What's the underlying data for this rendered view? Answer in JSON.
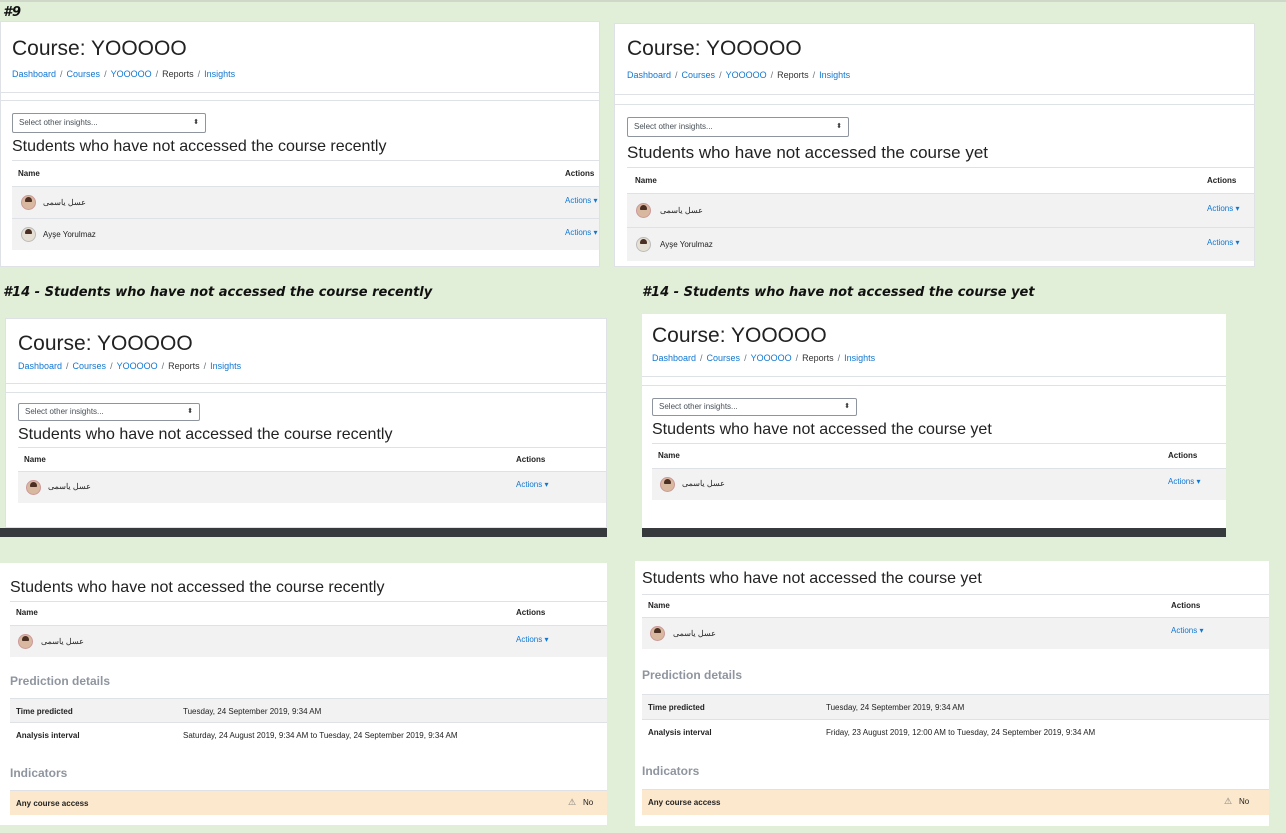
{
  "labels": {
    "p9": "#9",
    "p14_recent": "#14 - Students who have not accessed the course recently",
    "p14_yet": "#14 - Students who have not accessed the course yet"
  },
  "course": {
    "title": "Course: YOOOOO",
    "breadcrumb": [
      "Dashboard",
      "Courses",
      "YOOOOO",
      "Reports",
      "Insights"
    ],
    "breadcrumb_sep": "/"
  },
  "select": {
    "label": "Select other insights...",
    "caret": "⬍"
  },
  "insights": {
    "recent": "Students who have not accessed the course recently",
    "yet": "Students who have not accessed the course yet"
  },
  "table": {
    "col_name": "Name",
    "col_actions": "Actions",
    "action_label": "Actions ▾"
  },
  "users": [
    "عسل یاسمی",
    "Ayşe Yorulmaz"
  ],
  "prediction": {
    "title": "Prediction details",
    "time_label": "Time predicted",
    "interval_label": "Analysis interval",
    "recent": {
      "time": "Tuesday, 24 September 2019, 9:34 AM",
      "interval": "Saturday, 24 August 2019, 9:34 AM to Tuesday, 24 September 2019, 9:34 AM"
    },
    "yet": {
      "time": "Tuesday, 24 September 2019, 9:34 AM",
      "interval": "Friday, 23 August 2019, 12:00 AM to Tuesday, 24 September 2019, 9:34 AM"
    }
  },
  "indicators": {
    "title": "Indicators",
    "name": "Any course access",
    "value": "No",
    "warn_icon": "⚠"
  },
  "colors": {
    "link": "#1177d1",
    "background": "#e1eed8",
    "indicator_row": "#fce8cc"
  }
}
